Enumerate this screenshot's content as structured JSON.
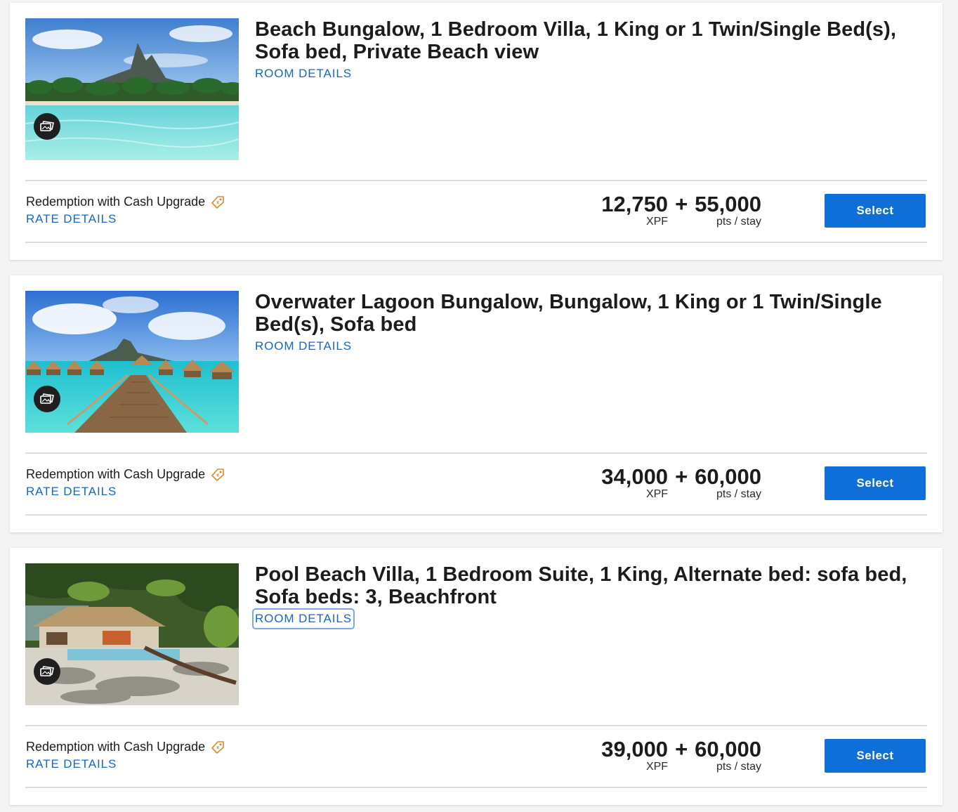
{
  "rooms": [
    {
      "title": "Beach Bungalow, 1 Bedroom Villa, 1 King or 1 Twin/Single Bed(s), Sofa bed, Private Beach view",
      "room_details_label": "ROOM DETAILS",
      "rate_name": "Redemption with Cash Upgrade",
      "rate_details_label": "RATE DETAILS",
      "cash_amount": "12,750",
      "cash_unit": "XPF",
      "plus": "+",
      "points_amount": "55,000",
      "points_unit": "pts / stay",
      "select_label": "Select"
    },
    {
      "title": "Overwater Lagoon Bungalow, Bungalow, 1 King or 1 Twin/Single Bed(s), Sofa bed",
      "room_details_label": "ROOM DETAILS",
      "rate_name": "Redemption with Cash Upgrade",
      "rate_details_label": "RATE DETAILS",
      "cash_amount": "34,000",
      "cash_unit": "XPF",
      "plus": "+",
      "points_amount": "60,000",
      "points_unit": "pts / stay",
      "select_label": "Select"
    },
    {
      "title": "Pool Beach Villa, 1 Bedroom Suite, 1 King, Alternate bed: sofa bed, Sofa beds: 3, Beachfront",
      "room_details_label": "ROOM DETAILS",
      "rate_name": "Redemption with Cash Upgrade",
      "rate_details_label": "RATE DETAILS",
      "cash_amount": "39,000",
      "cash_unit": "XPF",
      "plus": "+",
      "points_amount": "60,000",
      "points_unit": "pts / stay",
      "select_label": "Select"
    }
  ],
  "colors": {
    "link": "#1467c8",
    "button": "#0f6fd8",
    "tag_icon": "#e0892a",
    "divider": "#dcdcdc"
  },
  "icons": {
    "gallery": "gallery-icon",
    "tag": "offer-tag-icon"
  }
}
